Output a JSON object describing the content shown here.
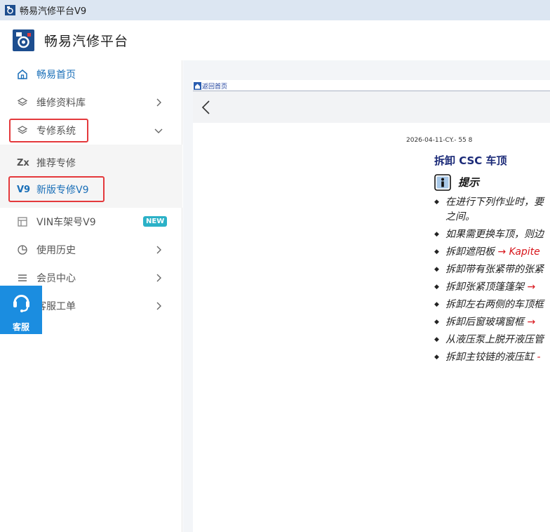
{
  "window": {
    "title": "畅易汽修平台V9"
  },
  "brand": {
    "name": "畅易汽修平台"
  },
  "sidebar": {
    "items": [
      {
        "label": "畅易首页",
        "icon": "home-icon",
        "active": true
      },
      {
        "label": "维修资料库",
        "icon": "layers-icon"
      },
      {
        "label": "专修系统",
        "icon": "layers-icon",
        "expanded": true
      },
      {
        "label": "VIN车架号V9",
        "icon": "table-icon",
        "badge": "NEW"
      },
      {
        "label": "使用历史",
        "icon": "pie-chart-icon"
      },
      {
        "label": "会员中心",
        "icon": "menu-icon"
      },
      {
        "label": "客服工单",
        "icon": "ticket-icon"
      }
    ],
    "submenu": [
      {
        "tag": "Zx",
        "label": "推荐专修"
      },
      {
        "tag": "V9",
        "label": "新版专修V9"
      }
    ]
  },
  "kefu": {
    "label": "客服",
    "icon": "headset-icon"
  },
  "content": {
    "home_link": "返回首页",
    "doc_code": "2026-04-11-CY.- 55 8",
    "doc_title": "拆卸 CSC 车顶",
    "tip_title": "提示",
    "bullets": [
      {
        "text": "在进行下列作业时，要",
        "red": ""
      },
      {
        "text": "之间。",
        "red": "",
        "continuation": true
      },
      {
        "text": "如果需更换车顶，则边",
        "red": ""
      },
      {
        "text": "拆卸遮阳板 ",
        "red": "→ Kapite"
      },
      {
        "text": "拆卸带有张紧带的张紧",
        "red": ""
      },
      {
        "text": "拆卸张紧顶篷篷架 ",
        "red": "→"
      },
      {
        "text": "拆卸左右两侧的车顶框",
        "red": ""
      },
      {
        "text": "拆卸后窗玻璃窗框 ",
        "red": "→"
      },
      {
        "text": "从液压泵上脱开液压管",
        "red": ""
      },
      {
        "text": "拆卸主铰链的液压缸 ",
        "red": "-"
      }
    ]
  },
  "colors": {
    "accent": "#1a6fb8",
    "highlight": "#e4393c",
    "badge": "#2bb1c7",
    "kefu": "#1b8de0",
    "doc_title": "#1b2a78"
  }
}
